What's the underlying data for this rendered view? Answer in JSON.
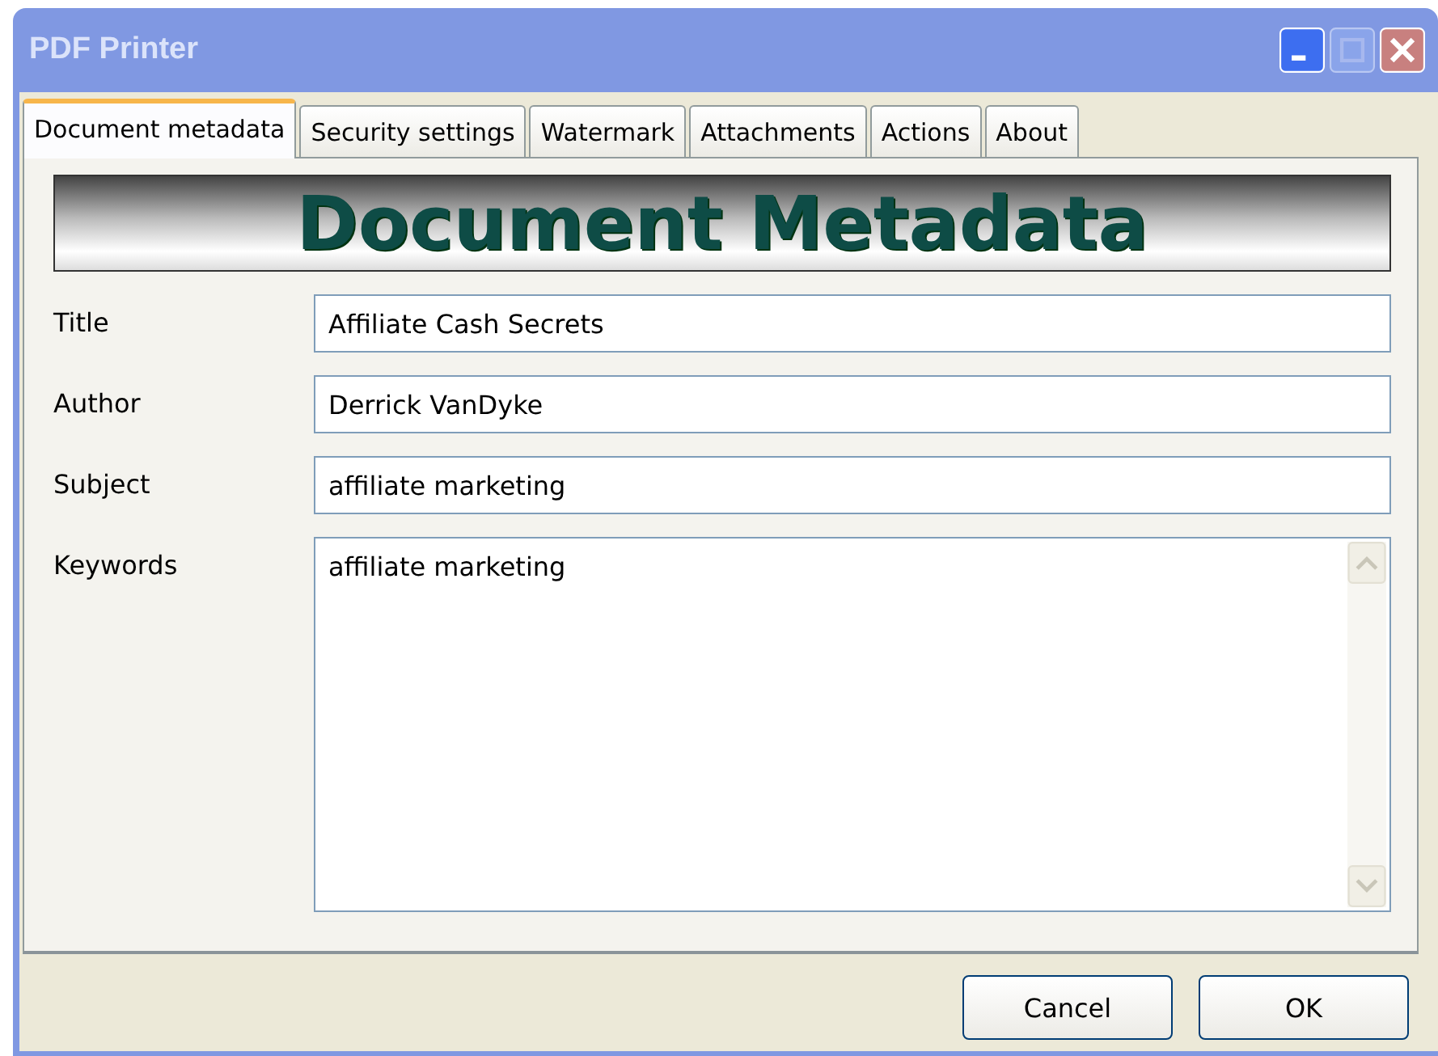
{
  "window": {
    "title": "PDF Printer",
    "active": false
  },
  "tabs": [
    {
      "label": "Document metadata",
      "selected": true
    },
    {
      "label": "Security settings",
      "selected": false
    },
    {
      "label": "Watermark",
      "selected": false
    },
    {
      "label": "Attachments",
      "selected": false
    },
    {
      "label": "Actions",
      "selected": false
    },
    {
      "label": "About",
      "selected": false
    }
  ],
  "banner": "Document Metadata",
  "fields": [
    {
      "label": "Title",
      "value": "Affiliate Cash Secrets",
      "kind": "line"
    },
    {
      "label": "Author",
      "value": "Derrick VanDyke",
      "kind": "line"
    },
    {
      "label": "Subject",
      "value": "affiliate marketing",
      "kind": "line"
    },
    {
      "label": "Keywords",
      "value": "affiliate marketing",
      "kind": "area"
    }
  ],
  "buttons": [
    "Cancel",
    "OK"
  ]
}
